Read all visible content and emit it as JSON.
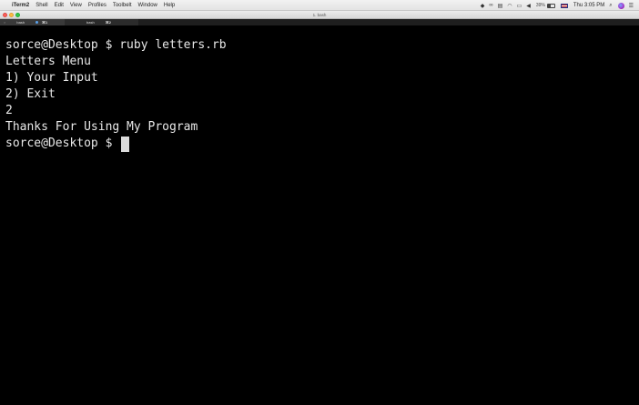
{
  "menubar": {
    "apple_glyph": "",
    "app_name": "iTerm2",
    "items": [
      "Shell",
      "Edit",
      "View",
      "Profiles",
      "Toolbelt",
      "Window",
      "Help"
    ],
    "battery_percent": "39%",
    "clock": "Thu 3:05 PM"
  },
  "window": {
    "title": "1. bash"
  },
  "tabs": [
    {
      "label": "bash",
      "shortcut": "⌘1"
    },
    {
      "label": "bash",
      "shortcut": "⌘2"
    }
  ],
  "terminal": {
    "lines": [
      "sorce@Desktop $ ruby letters.rb",
      "Letters Menu",
      "1) Your Input",
      "2) Exit",
      "2",
      "Thanks For Using My Program"
    ],
    "prompt": "sorce@Desktop $ "
  },
  "colors": {
    "terminal_bg": "#000000",
    "terminal_fg": "#e8e8e8",
    "cursor": "#dcdcdc"
  },
  "icons": [
    "apple-icon",
    "vpn-icon",
    "infinity-icon",
    "clipboard-icon",
    "wifi-icon",
    "airplay-icon",
    "volume-icon",
    "battery-icon",
    "flag-icon",
    "spotlight-icon",
    "siri-icon",
    "notification-center-icon"
  ]
}
